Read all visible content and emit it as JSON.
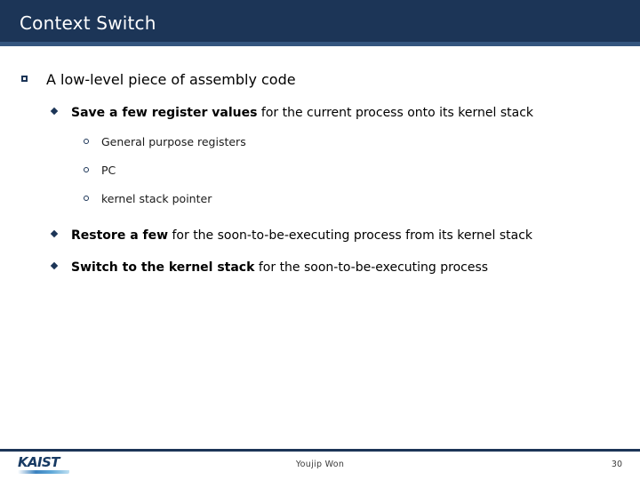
{
  "slide": {
    "title": "Context Switch",
    "colors": {
      "header_bg": "#1c3557",
      "header_stripe": "#35567f",
      "title_text": "#ffffff",
      "marker": "#1c3557",
      "body_text": "#000000",
      "footer_rule": "#1c3557",
      "logo_text": "#173a63"
    }
  },
  "content": {
    "level1": {
      "marker": "hollow-square",
      "text": "A low-level piece of assembly code"
    },
    "bullets": [
      {
        "marker": "diamond",
        "bold": "Save a few register values",
        "rest": " for the current process onto its kernel stack"
      },
      {
        "marker": "diamond",
        "bold": "Restore a few",
        "rest": " for the soon-to-be-executing process from its kernel stack"
      },
      {
        "marker": "diamond",
        "bold": "Switch to the kernel stack",
        "rest": " for the soon-to-be-executing process"
      }
    ],
    "sub_items": [
      {
        "marker": "hollow-circle",
        "text": "General purpose registers"
      },
      {
        "marker": "hollow-circle",
        "text": "PC"
      },
      {
        "marker": "hollow-circle",
        "text": "kernel stack pointer"
      }
    ]
  },
  "footer": {
    "logo_text": "KAIST",
    "author": "Youjip Won",
    "page_number": "30"
  }
}
